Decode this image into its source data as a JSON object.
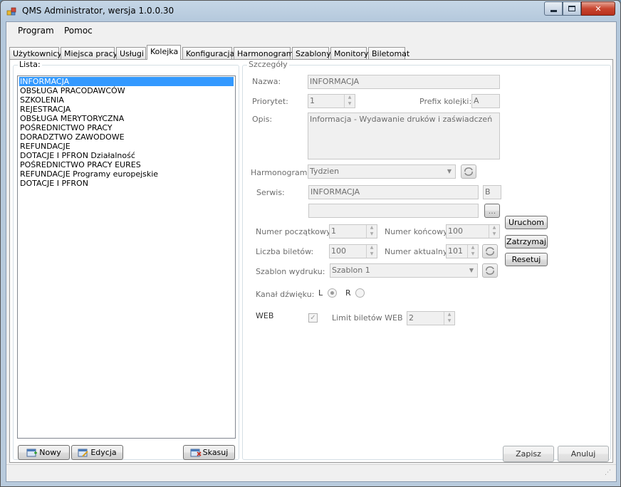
{
  "window": {
    "title": "QMS Administrator, wersja 1.0.0.30"
  },
  "menu": {
    "program": "Program",
    "pomoc": "Pomoc"
  },
  "tabs": [
    {
      "label": "Użytkownicy"
    },
    {
      "label": "Miejsca pracy"
    },
    {
      "label": "Usługi"
    },
    {
      "label": "Kolejka"
    },
    {
      "label": "Konfiguracja"
    },
    {
      "label": "Harmonogramy"
    },
    {
      "label": "Szablony"
    },
    {
      "label": "Monitory"
    },
    {
      "label": "Biletomat"
    }
  ],
  "lista": {
    "title": "Lista:",
    "items": [
      "INFORMACJA",
      "OBSŁUGA PRACODAWCÓW",
      "SZKOLENIA",
      "REJESTRACJA",
      "OBSŁUGA MERYTORYCZNA",
      "POŚREDNICTWO PRACY",
      "DORADZTWO ZAWODOWE",
      "REFUNDACJE",
      "DOTACJE I PFRON Działalność",
      "POŚREDNICTWO PRACY EURES",
      "REFUNDACJE  Programy europejskie",
      "DOTACJE I PFRON"
    ],
    "selected_index": 0,
    "nowy_label": "Nowy",
    "edycja_label": "Edycja",
    "skasuj_label": "Skasuj"
  },
  "szczegoly": {
    "title": "Szczegóły",
    "nazwa_label": "Nazwa:",
    "nazwa_value": "INFORMACJA",
    "priorytet_label": "Priorytet:",
    "priorytet_value": "1",
    "prefix_label": "Prefix kolejki:",
    "prefix_value": "A",
    "opis_label": "Opis:",
    "opis_value": "Informacja - Wydawanie druków i zaświadczeń",
    "harmonogram_label": "Harmonogram:",
    "harmonogram_value": "Tydzien",
    "serwis_label": "Serwis:",
    "serwis_value": "INFORMACJA",
    "serwis_code": "B",
    "serwis2_value": "",
    "browse_label": "...",
    "uruchom_label": "Uruchom",
    "zatrzymaj_label": "Zatrzymaj",
    "resetuj_label": "Resetuj",
    "numer_poczatkowy_label": "Numer początkowy:",
    "numer_poczatkowy_value": "1",
    "numer_koncowy_label": "Numer końcowy:",
    "numer_koncowy_value": "100",
    "liczba_biletow_label": "Liczba biletów:",
    "liczba_biletow_value": "100",
    "numer_aktualny_label": "Numer aktualny:",
    "numer_aktualny_value": "101",
    "szablon_label": "Szablon wydruku:",
    "szablon_value": "Szablon 1",
    "kanal_label": "Kanał dźwięku:",
    "kanal_l": "L",
    "kanal_r": "R",
    "web_label": "WEB",
    "limit_label": "Limit biletów WEB",
    "limit_value": "2",
    "zapisz_label": "Zapisz",
    "anuluj_label": "Anuluj"
  },
  "colors": {
    "selection": "#3399ff",
    "close_button": "#c84630"
  }
}
